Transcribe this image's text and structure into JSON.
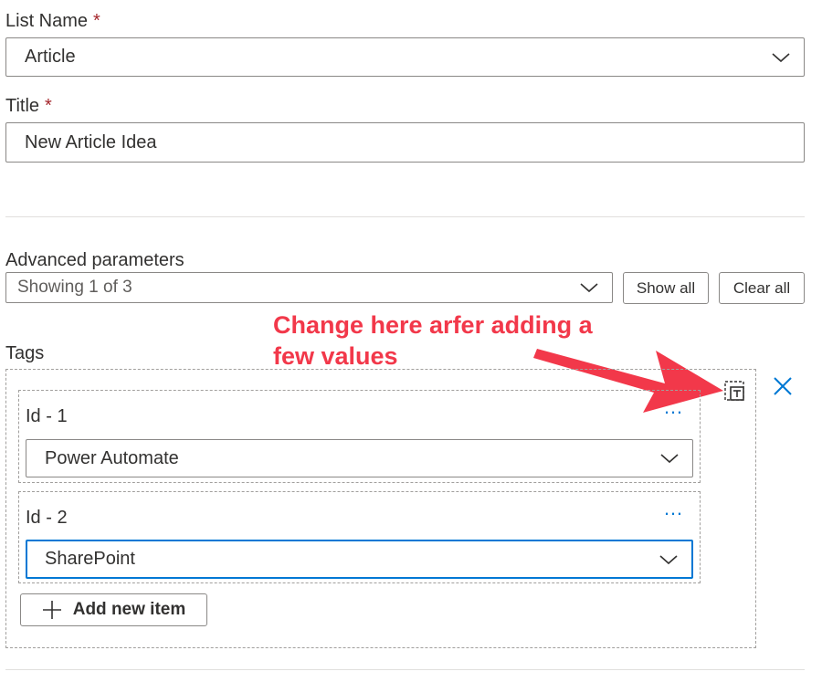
{
  "list_name": {
    "label": "List Name",
    "required_mark": "*",
    "value": "Article"
  },
  "title_field": {
    "label": "Title",
    "required_mark": "*",
    "value": "New Article Idea"
  },
  "advanced": {
    "label": "Advanced parameters",
    "dropdown_value": "Showing 1 of 3",
    "show_all_label": "Show all",
    "clear_all_label": "Clear all"
  },
  "tags": {
    "label": "Tags",
    "items": [
      {
        "id_label": "Id - 1",
        "value": "Power Automate",
        "menu": "…"
      },
      {
        "id_label": "Id - 2",
        "value": "SharePoint",
        "menu": "…"
      }
    ],
    "add_label": "Add new item"
  },
  "annotation": {
    "line1": "Change here arfer adding a",
    "line2": "few values",
    "color": "#f2384a"
  },
  "colors": {
    "accent": "#0078d4",
    "required": "#a4262c"
  }
}
